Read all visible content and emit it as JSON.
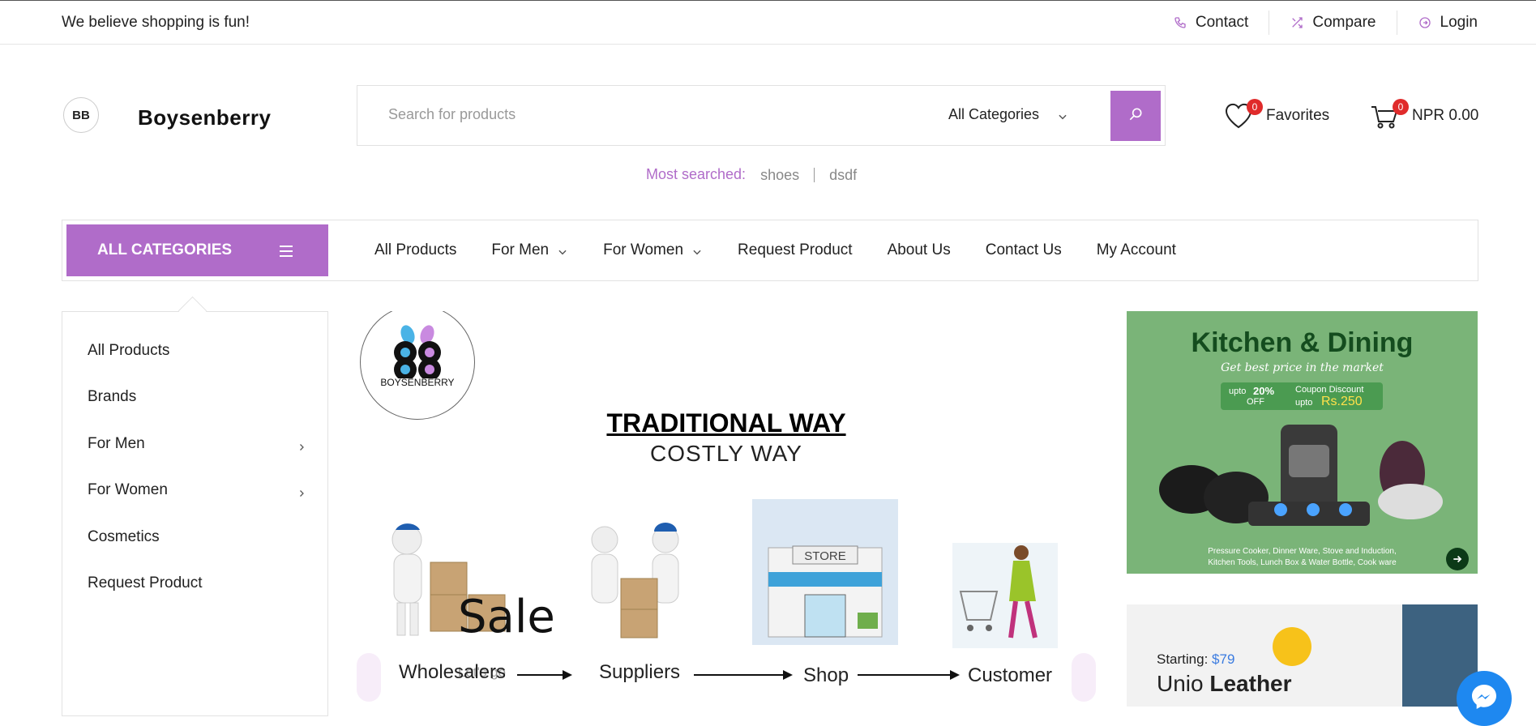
{
  "topbar": {
    "tagline": "We believe shopping is fun!",
    "links": [
      {
        "label": "Contact",
        "icon": "phone-icon"
      },
      {
        "label": "Compare",
        "icon": "shuffle-icon"
      },
      {
        "label": "Login",
        "icon": "login-icon"
      }
    ]
  },
  "header": {
    "brand": "Boysenberry",
    "logo_text": "BB",
    "search": {
      "placeholder": "Search for products",
      "category": "All Categories"
    },
    "most_searched": {
      "label": "Most searched:",
      "keywords": [
        "shoes",
        "dsdf"
      ]
    },
    "favorites": {
      "label": "Favorites",
      "count": "0"
    },
    "cart": {
      "label": "NPR 0.00",
      "count": "0"
    }
  },
  "nav": {
    "all_categories": "ALL CATEGORIES",
    "items": [
      {
        "label": "All Products"
      },
      {
        "label": "For Men"
      },
      {
        "label": "For Women"
      },
      {
        "label": "Request Product"
      },
      {
        "label": "About Us"
      },
      {
        "label": "Contact Us"
      },
      {
        "label": "My Account"
      }
    ]
  },
  "sidebar": {
    "items": [
      {
        "label": "All Products"
      },
      {
        "label": "Brands"
      },
      {
        "label": "For Men"
      },
      {
        "label": "For Women"
      },
      {
        "label": "Cosmetics"
      },
      {
        "label": "Request Product"
      }
    ]
  },
  "banner": {
    "logo_wordmark": "BOYSENBERRY",
    "heading": "TRADITIONAL WAY",
    "subheading": "COSTLY WAY",
    "overlay_title": "Sale",
    "overlay_sub": "Let's go",
    "steps": [
      "Wholesalers",
      "Suppliers",
      "Shop",
      "Customer"
    ],
    "store_sign": "STORE"
  },
  "promo1": {
    "title": "Kitchen & Dining",
    "subtitle": "Get best price in the market",
    "coupon_upto": "upto",
    "coupon_pct": "20%",
    "coupon_off": "OFF",
    "coupon_label": "Coupon Discount",
    "coupon_amount_prefix": "upto",
    "coupon_amount": "Rs.250",
    "footer_line1": "Pressure Cooker, Dinner Ware, Stove and Induction,",
    "footer_line2": "Kitchen Tools, Lunch Box & Water Bottle, Cook ware"
  },
  "promo2": {
    "starting_label": "Starting:",
    "price": "$79",
    "title_plain": "Unio",
    "title_bold": "Leather"
  },
  "colors": {
    "accent": "#b06cc9",
    "badge": "#e02b2b",
    "promo_green": "#7ab478",
    "messenger": "#1e88f0"
  }
}
